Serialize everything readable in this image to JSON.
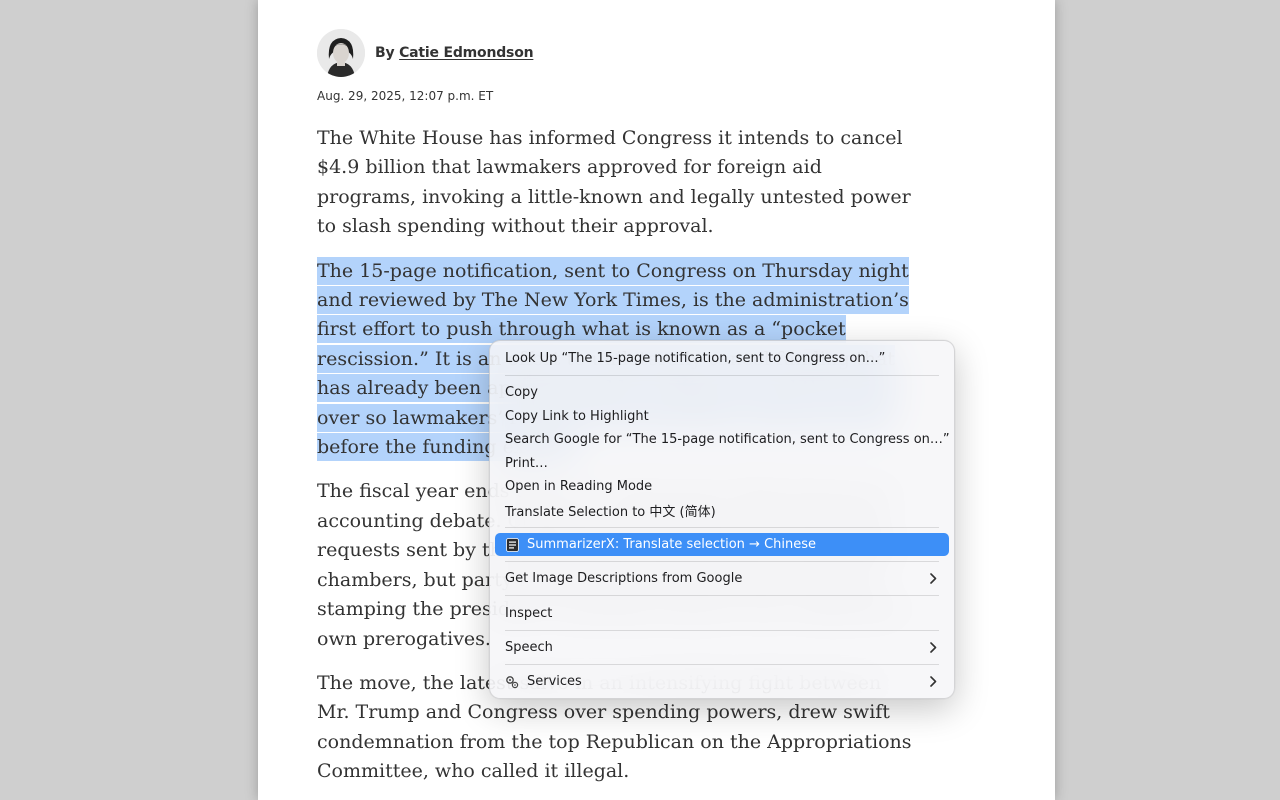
{
  "byline": {
    "prefix": "By",
    "author": "Catie Edmondson"
  },
  "dateline": "Aug. 29, 2025, 12:07 p.m. ET",
  "article": {
    "paragraphs": [
      "The White House has informed Congress it intends to cancel $4.9 billion that lawmakers approved for foreign aid programs, invoking a little-known and legally untested power to slash spending without their approval.",
      "The 15-page notification, sent to Congress on Thursday night and reviewed by The New York Times, is the administration’s first effort to push through what is known as a “pocket rescission.” It is an effort to unilaterally cancel funding that has already been appropriated by waiting to send the freeze over so lawmakers’ request that lawmakers cannot act on it before the funding expires.",
      "The fiscal year ends Sept. 30, which leaves little time for an accounting debate. Congress is required to review funding requests sent by the White House. Republicans control both chambers, but party leaders have been accused of rubber-stamping the president’s spending requests and ceding their own prerogatives.",
      "The move, the latest salvo in an intensifying fight between Mr. Trump and Congress over spending powers, drew swift condemnation from the top Republican on the Appropriations Committee, who called it illegal."
    ],
    "highlighted_index": 1
  },
  "context_menu": {
    "look_up": "Look Up “The 15-page notification, sent to Congress on…”",
    "copy": "Copy",
    "copy_link": "Copy Link to Highlight",
    "search_google": "Search Google for “The 15-page notification, sent to Congress on…”",
    "print": "Print…",
    "reading_mode": "Open in Reading Mode",
    "translate": "Translate Selection to 中文 (简体)",
    "summarizer": "SummarizerX: Translate selection → Chinese",
    "image_descriptions": "Get Image Descriptions from Google",
    "inspect": "Inspect",
    "speech": "Speech",
    "services": "Services",
    "active_color": "#3d8ff7"
  },
  "colors": {
    "selection_highlight": "#b3d3fb",
    "body_text": "#333333",
    "backdrop": "#cfcfcf"
  },
  "icons": {
    "avatar": "author-portrait",
    "summarizer": "document-lines-icon",
    "services": "services-gears-icon",
    "submenu": "chevron-right-icon"
  }
}
